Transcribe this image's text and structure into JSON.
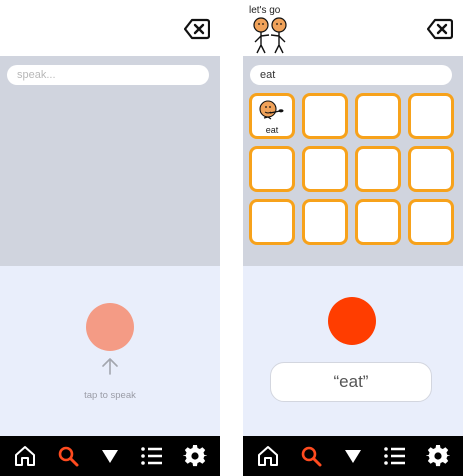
{
  "left_screen": {
    "search": {
      "placeholder": "speak...",
      "value": ""
    },
    "hint": "tap to speak",
    "colors": {
      "mic": "#f49b85"
    }
  },
  "right_screen": {
    "sentence_bar": {
      "phrase_label": "let's go"
    },
    "search": {
      "placeholder": "",
      "value": "eat"
    },
    "symbol_tiles": [
      {
        "label": "eat",
        "icon": "eat-symbol-icon"
      },
      {
        "label": ""
      },
      {
        "label": ""
      },
      {
        "label": ""
      },
      {
        "label": ""
      },
      {
        "label": ""
      },
      {
        "label": ""
      },
      {
        "label": ""
      },
      {
        "label": ""
      },
      {
        "label": ""
      },
      {
        "label": ""
      },
      {
        "label": ""
      }
    ],
    "result": "“eat”",
    "colors": {
      "mic": "#ff3d00"
    }
  },
  "nav": {
    "icons": [
      "home-icon",
      "search-icon",
      "triangle-down-icon",
      "list-icon",
      "gear-icon"
    ],
    "active": "search-icon",
    "accent": "#ff4b1f"
  },
  "colors": {
    "tile_border": "#f7a21b",
    "gray_area": "#d0d4de",
    "lower_area": "#e9eefb"
  }
}
